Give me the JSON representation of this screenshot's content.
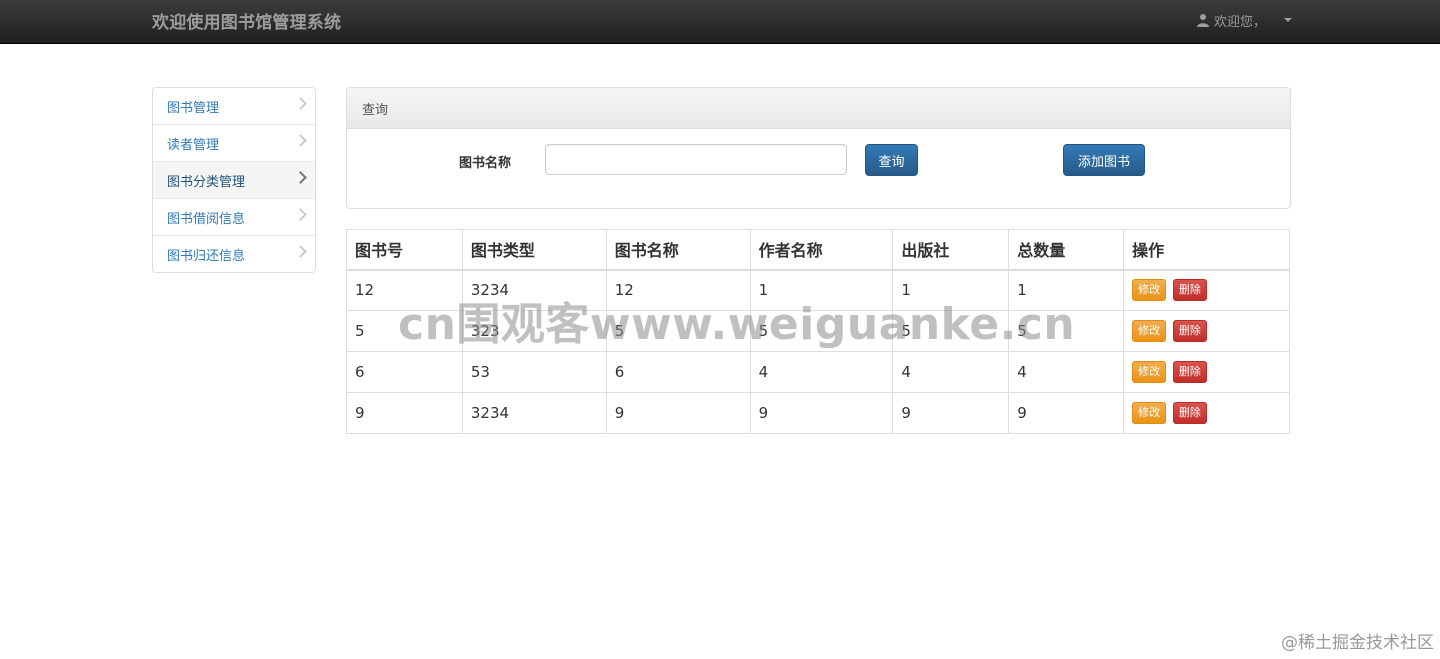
{
  "navbar": {
    "brand": "欢迎使用图书馆管理系统",
    "user_label": "欢迎您，",
    "icon": "user-icon"
  },
  "sidebar": {
    "items": [
      {
        "label": "图书管理",
        "icon": "chevron-right-icon"
      },
      {
        "label": "读者管理",
        "icon": "chevron-right-icon"
      },
      {
        "label": "图书分类管理",
        "icon": "chevron-right-icon",
        "active": true
      },
      {
        "label": "图书借阅信息",
        "icon": "chevron-right-icon"
      },
      {
        "label": "图书归还信息",
        "icon": "chevron-right-icon"
      }
    ]
  },
  "query_panel": {
    "heading": "查询",
    "search_label": "图书名称",
    "search_value": "",
    "search_placeholder": "",
    "query_button": "查询",
    "add_button": "添加图书"
  },
  "table": {
    "headers": [
      "图书号",
      "图书类型",
      "图书名称",
      "作者名称",
      "出版社",
      "总数量",
      "操作"
    ],
    "rows": [
      [
        "12",
        "3234",
        "12",
        "1",
        "1",
        "1"
      ],
      [
        "5",
        "323",
        "5",
        "5",
        "5",
        "5"
      ],
      [
        "6",
        "53",
        "6",
        "4",
        "4",
        "4"
      ],
      [
        "9",
        "3234",
        "9",
        "9",
        "9",
        "9"
      ]
    ],
    "edit_label": "修改",
    "delete_label": "删除"
  },
  "watermark": "cn围观客www.weiguanke.cn",
  "footer_mark": "@稀土掘金技术社区",
  "colors": {
    "primary": "#337ab7",
    "warning": "#f0ad4e",
    "danger": "#d9534f",
    "navbar": "#222222"
  }
}
